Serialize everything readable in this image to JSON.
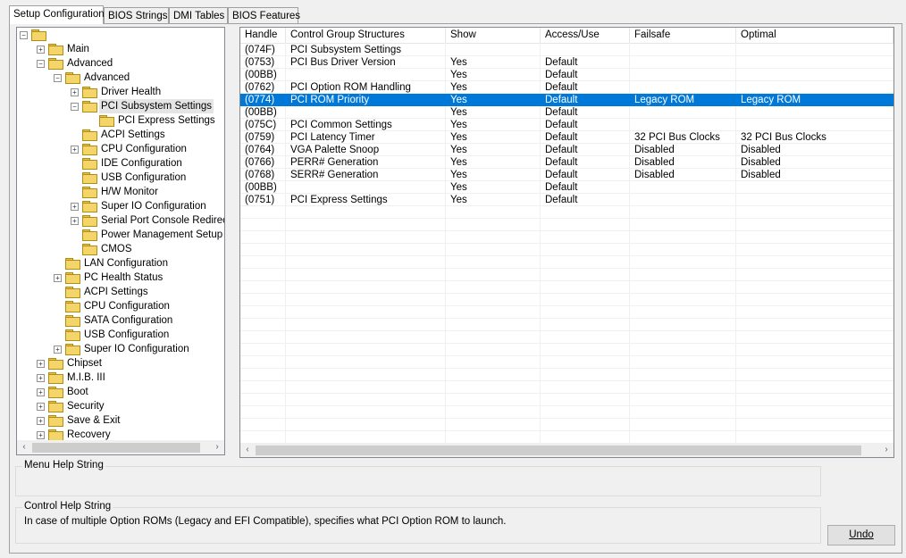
{
  "tabs": [
    {
      "label": "Setup Configuration",
      "active": true
    },
    {
      "label": "BIOS Strings",
      "active": false
    },
    {
      "label": "DMI Tables",
      "active": false
    },
    {
      "label": "BIOS Features",
      "active": false
    }
  ],
  "tree": {
    "root_label": "",
    "items": [
      {
        "label": "Main",
        "expander": "+"
      },
      {
        "label": "Advanced",
        "expander": "-"
      },
      {
        "label": "Advanced",
        "expander": "-"
      },
      {
        "label": "Driver Health",
        "expander": "+"
      },
      {
        "label": "PCI Subsystem Settings",
        "expander": "-",
        "selected": true
      },
      {
        "label": "PCI Express Settings",
        "expander": ""
      },
      {
        "label": "ACPI Settings",
        "expander": ""
      },
      {
        "label": "CPU Configuration",
        "expander": "+"
      },
      {
        "label": "IDE Configuration",
        "expander": ""
      },
      {
        "label": "USB Configuration",
        "expander": ""
      },
      {
        "label": "H/W Monitor",
        "expander": ""
      },
      {
        "label": "Super IO Configuration",
        "expander": "+"
      },
      {
        "label": "Serial Port Console Redirection",
        "expander": "+"
      },
      {
        "label": "Power Management Setup",
        "expander": ""
      },
      {
        "label": "CMOS",
        "expander": ""
      },
      {
        "label": "LAN Configuration",
        "expander": ""
      },
      {
        "label": "PC Health Status",
        "expander": "+"
      },
      {
        "label": "ACPI Settings",
        "expander": ""
      },
      {
        "label": "CPU Configuration",
        "expander": ""
      },
      {
        "label": "SATA Configuration",
        "expander": ""
      },
      {
        "label": "USB Configuration",
        "expander": ""
      },
      {
        "label": "Super IO Configuration",
        "expander": "+"
      },
      {
        "label": "Chipset",
        "expander": "+"
      },
      {
        "label": "M.I.B. III",
        "expander": "+"
      },
      {
        "label": "Boot",
        "expander": "+"
      },
      {
        "label": "Security",
        "expander": "+"
      },
      {
        "label": "Save & Exit",
        "expander": "+"
      },
      {
        "label": "Recovery",
        "expander": "+"
      }
    ]
  },
  "grid": {
    "columns": [
      "Handle",
      "Control Group Structures",
      "Show",
      "Access/Use",
      "Failsafe",
      "Optimal"
    ],
    "rows": [
      [
        "(074F)",
        "PCI Subsystem Settings",
        "",
        "",
        "",
        ""
      ],
      [
        "(0753)",
        "PCI Bus Driver Version",
        "Yes",
        "Default",
        "",
        ""
      ],
      [
        "(00BB)",
        "",
        "Yes",
        "Default",
        "",
        ""
      ],
      [
        "(0762)",
        "PCI Option ROM Handling",
        "Yes",
        "Default",
        "",
        ""
      ],
      [
        "(0774)",
        "PCI ROM Priority",
        "Yes",
        "Default",
        "Legacy ROM",
        "Legacy ROM"
      ],
      [
        "(00BB)",
        "",
        "Yes",
        "Default",
        "",
        ""
      ],
      [
        "(075C)",
        "PCI Common Settings",
        "Yes",
        "Default",
        "",
        ""
      ],
      [
        "(0759)",
        "PCI Latency Timer",
        "Yes",
        "Default",
        "32 PCI Bus Clocks",
        "32 PCI Bus Clocks"
      ],
      [
        "(0764)",
        "VGA Palette Snoop",
        "Yes",
        "Default",
        "Disabled",
        "Disabled"
      ],
      [
        "(0766)",
        "PERR# Generation",
        "Yes",
        "Default",
        "Disabled",
        "Disabled"
      ],
      [
        "(0768)",
        "SERR# Generation",
        "Yes",
        "Default",
        "Disabled",
        "Disabled"
      ],
      [
        "(00BB)",
        "",
        "Yes",
        "Default",
        "",
        ""
      ],
      [
        "(0751)",
        "PCI Express Settings",
        "Yes",
        "Default",
        "",
        ""
      ]
    ],
    "selected_row": 4
  },
  "help": {
    "menu_label": "Menu Help String",
    "menu_text": "",
    "control_label": "Control Help String",
    "control_text": "In case of multiple Option ROMs (Legacy and EFI Compatible), specifies what PCI Option ROM to launch."
  },
  "undo_label": "Undo",
  "scroll": {
    "left": "‹",
    "right": "›"
  },
  "colors": {
    "selection": "#0078d7",
    "folder": "#f3d56a"
  }
}
